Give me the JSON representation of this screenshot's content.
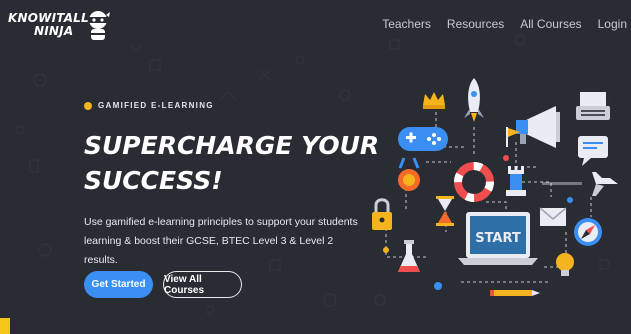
{
  "brand": {
    "line1": "KNOWITALL",
    "line2": "NINJA",
    "icon": "ninja-mascot-icon"
  },
  "nav": {
    "items": [
      {
        "label": "Teachers"
      },
      {
        "label": "Resources"
      },
      {
        "label": "All Courses"
      },
      {
        "label": "Login"
      }
    ]
  },
  "hero": {
    "tag": "GAMIFIED E-LEARNING",
    "title_line1": "SUPERCHARGE YOUR",
    "title_line2": "SUCCESS!",
    "description": "Use gamified e-learning principles to support your students learning & boost their GCSE, BTEC Level 3 & Level 2 results.",
    "primary_button": "Get Started",
    "secondary_button": "View All Courses"
  },
  "illustration": {
    "screen_label": "START",
    "icons": [
      "crown-icon",
      "rocket-icon",
      "gamepad-icon",
      "megaphone-icon",
      "typewriter-icon",
      "chat-icon",
      "medal-icon",
      "lifebuoy-icon",
      "chess-rook-icon",
      "flag-icon",
      "airplane-icon",
      "padlock-icon",
      "hourglass-icon",
      "laptop-icon",
      "envelope-icon",
      "compass-icon",
      "flask-icon",
      "lightbulb-icon",
      "pencil-icon"
    ]
  },
  "colors": {
    "background": "#2a2c33",
    "accent": "#f5b41e",
    "primary": "#3b8ff3"
  }
}
